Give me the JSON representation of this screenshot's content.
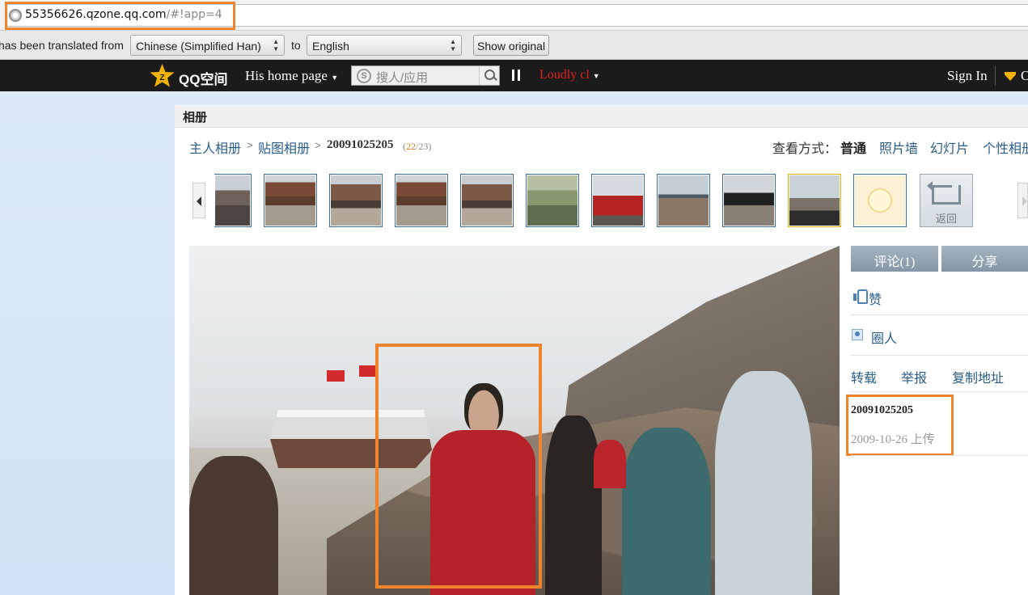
{
  "browser": {
    "url_host": "55356626.qzone.qq.com",
    "url_path": "/#!app=4"
  },
  "translate_bar": {
    "message": "has been translated from",
    "source_language": "Chinese (Simplified Han)",
    "to_label": "to",
    "target_language": "English",
    "show_original_label": "Show original"
  },
  "qq_nav": {
    "logo_text": "QQ空间",
    "home_label": "His home page",
    "search_placeholder": "搜人/应用",
    "loudly_label": "Loudly cl",
    "sign_in_label": "Sign In",
    "trailing_label": "O"
  },
  "album": {
    "section_title": "相册",
    "breadcrumb": [
      "主人相册",
      "贴图相册"
    ],
    "breadcrumb_separator": ">",
    "current_album": "20091025205",
    "count_current": "22",
    "count_total": "/23)",
    "count_open": "(",
    "view_mode_label": "查看方式：",
    "view_modes": [
      "普通",
      "照片墙",
      "幻灯片",
      "个性相册"
    ],
    "back_label": "返回"
  },
  "right_panel": {
    "comment_tab": "评论(1)",
    "share_tab": "分享",
    "like_label": "赞",
    "circle_label": "圈人",
    "actions": [
      "转载",
      "举报",
      "复制地址"
    ],
    "photo_name": "20091025205",
    "upload_info": "2009-10-26 上传"
  },
  "colors": {
    "highlight": "#f0842c",
    "link": "#2a5d88",
    "nav_bg": "#1b1b1b"
  }
}
